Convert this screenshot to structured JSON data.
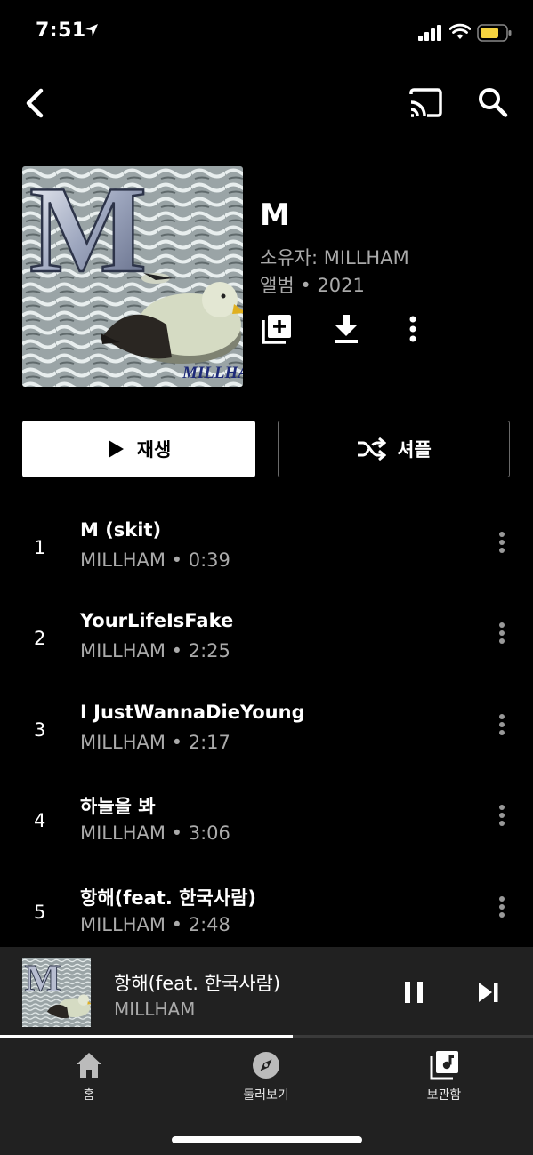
{
  "status_bar": {
    "time": "7:51"
  },
  "album": {
    "title": "M",
    "owner": "소유자: MILLHAM",
    "meta": "앨범 • 2021",
    "art_text": "M",
    "art_signature": "MILLHAM"
  },
  "buttons": {
    "play_label": "재생",
    "shuffle_label": "셔플"
  },
  "tracks": [
    {
      "num": "1",
      "title": "M (skit)",
      "subtitle": "MILLHAM • 0:39"
    },
    {
      "num": "2",
      "title": "YourLifeIsFake",
      "subtitle": "MILLHAM • 2:25"
    },
    {
      "num": "3",
      "title": "I JustWannaDieYoung",
      "subtitle": "MILLHAM • 2:17"
    },
    {
      "num": "4",
      "title": "하늘을 봐",
      "subtitle": "MILLHAM • 3:06"
    },
    {
      "num": "5",
      "title": "항해(feat. 한국사람)",
      "subtitle": "MILLHAM • 2:48"
    }
  ],
  "now_playing": {
    "title": "항해(feat. 한국사람)",
    "artist": "MILLHAM",
    "progress": 0.55
  },
  "bottom_nav": [
    {
      "label": "홈",
      "icon": "home-icon"
    },
    {
      "label": "둘러보기",
      "icon": "explore-icon"
    },
    {
      "label": "보관함",
      "icon": "library-icon"
    }
  ],
  "colors": {
    "background": "#000000",
    "surface": "#212121",
    "secondary_text": "#aaaaaa",
    "battery": "#f5d33f"
  }
}
